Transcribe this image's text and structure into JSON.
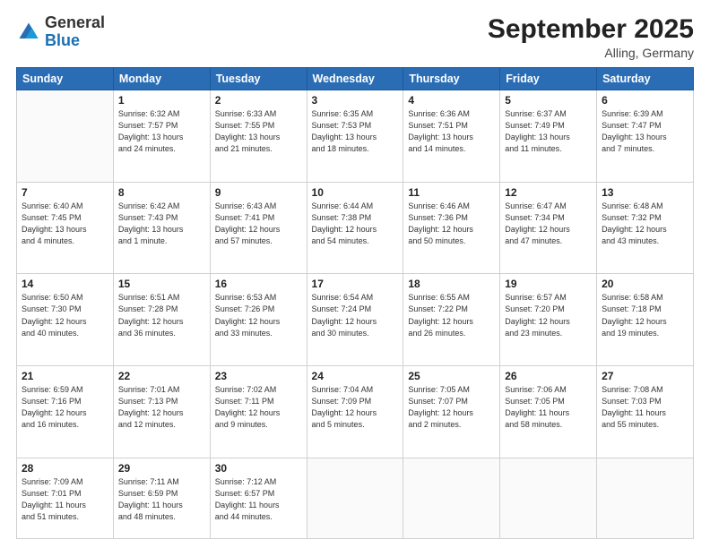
{
  "header": {
    "logo_general": "General",
    "logo_blue": "Blue",
    "month_title": "September 2025",
    "location": "Alling, Germany"
  },
  "days_of_week": [
    "Sunday",
    "Monday",
    "Tuesday",
    "Wednesday",
    "Thursday",
    "Friday",
    "Saturday"
  ],
  "weeks": [
    [
      {
        "num": "",
        "info": ""
      },
      {
        "num": "1",
        "info": "Sunrise: 6:32 AM\nSunset: 7:57 PM\nDaylight: 13 hours\nand 24 minutes."
      },
      {
        "num": "2",
        "info": "Sunrise: 6:33 AM\nSunset: 7:55 PM\nDaylight: 13 hours\nand 21 minutes."
      },
      {
        "num": "3",
        "info": "Sunrise: 6:35 AM\nSunset: 7:53 PM\nDaylight: 13 hours\nand 18 minutes."
      },
      {
        "num": "4",
        "info": "Sunrise: 6:36 AM\nSunset: 7:51 PM\nDaylight: 13 hours\nand 14 minutes."
      },
      {
        "num": "5",
        "info": "Sunrise: 6:37 AM\nSunset: 7:49 PM\nDaylight: 13 hours\nand 11 minutes."
      },
      {
        "num": "6",
        "info": "Sunrise: 6:39 AM\nSunset: 7:47 PM\nDaylight: 13 hours\nand 7 minutes."
      }
    ],
    [
      {
        "num": "7",
        "info": "Sunrise: 6:40 AM\nSunset: 7:45 PM\nDaylight: 13 hours\nand 4 minutes."
      },
      {
        "num": "8",
        "info": "Sunrise: 6:42 AM\nSunset: 7:43 PM\nDaylight: 13 hours\nand 1 minute."
      },
      {
        "num": "9",
        "info": "Sunrise: 6:43 AM\nSunset: 7:41 PM\nDaylight: 12 hours\nand 57 minutes."
      },
      {
        "num": "10",
        "info": "Sunrise: 6:44 AM\nSunset: 7:38 PM\nDaylight: 12 hours\nand 54 minutes."
      },
      {
        "num": "11",
        "info": "Sunrise: 6:46 AM\nSunset: 7:36 PM\nDaylight: 12 hours\nand 50 minutes."
      },
      {
        "num": "12",
        "info": "Sunrise: 6:47 AM\nSunset: 7:34 PM\nDaylight: 12 hours\nand 47 minutes."
      },
      {
        "num": "13",
        "info": "Sunrise: 6:48 AM\nSunset: 7:32 PM\nDaylight: 12 hours\nand 43 minutes."
      }
    ],
    [
      {
        "num": "14",
        "info": "Sunrise: 6:50 AM\nSunset: 7:30 PM\nDaylight: 12 hours\nand 40 minutes."
      },
      {
        "num": "15",
        "info": "Sunrise: 6:51 AM\nSunset: 7:28 PM\nDaylight: 12 hours\nand 36 minutes."
      },
      {
        "num": "16",
        "info": "Sunrise: 6:53 AM\nSunset: 7:26 PM\nDaylight: 12 hours\nand 33 minutes."
      },
      {
        "num": "17",
        "info": "Sunrise: 6:54 AM\nSunset: 7:24 PM\nDaylight: 12 hours\nand 30 minutes."
      },
      {
        "num": "18",
        "info": "Sunrise: 6:55 AM\nSunset: 7:22 PM\nDaylight: 12 hours\nand 26 minutes."
      },
      {
        "num": "19",
        "info": "Sunrise: 6:57 AM\nSunset: 7:20 PM\nDaylight: 12 hours\nand 23 minutes."
      },
      {
        "num": "20",
        "info": "Sunrise: 6:58 AM\nSunset: 7:18 PM\nDaylight: 12 hours\nand 19 minutes."
      }
    ],
    [
      {
        "num": "21",
        "info": "Sunrise: 6:59 AM\nSunset: 7:16 PM\nDaylight: 12 hours\nand 16 minutes."
      },
      {
        "num": "22",
        "info": "Sunrise: 7:01 AM\nSunset: 7:13 PM\nDaylight: 12 hours\nand 12 minutes."
      },
      {
        "num": "23",
        "info": "Sunrise: 7:02 AM\nSunset: 7:11 PM\nDaylight: 12 hours\nand 9 minutes."
      },
      {
        "num": "24",
        "info": "Sunrise: 7:04 AM\nSunset: 7:09 PM\nDaylight: 12 hours\nand 5 minutes."
      },
      {
        "num": "25",
        "info": "Sunrise: 7:05 AM\nSunset: 7:07 PM\nDaylight: 12 hours\nand 2 minutes."
      },
      {
        "num": "26",
        "info": "Sunrise: 7:06 AM\nSunset: 7:05 PM\nDaylight: 11 hours\nand 58 minutes."
      },
      {
        "num": "27",
        "info": "Sunrise: 7:08 AM\nSunset: 7:03 PM\nDaylight: 11 hours\nand 55 minutes."
      }
    ],
    [
      {
        "num": "28",
        "info": "Sunrise: 7:09 AM\nSunset: 7:01 PM\nDaylight: 11 hours\nand 51 minutes."
      },
      {
        "num": "29",
        "info": "Sunrise: 7:11 AM\nSunset: 6:59 PM\nDaylight: 11 hours\nand 48 minutes."
      },
      {
        "num": "30",
        "info": "Sunrise: 7:12 AM\nSunset: 6:57 PM\nDaylight: 11 hours\nand 44 minutes."
      },
      {
        "num": "",
        "info": ""
      },
      {
        "num": "",
        "info": ""
      },
      {
        "num": "",
        "info": ""
      },
      {
        "num": "",
        "info": ""
      }
    ]
  ]
}
